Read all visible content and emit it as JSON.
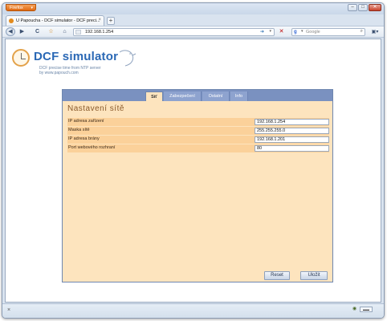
{
  "browser": {
    "app_button_label": "Firefox",
    "window_controls": {
      "minimize": "–",
      "maximize": "□",
      "close": "✕"
    },
    "tab": {
      "title": "U Papoucha - DCF simulator - DCF preci...",
      "close": "×"
    },
    "new_tab": "+",
    "nav": {
      "back": "◀",
      "forward": "▶",
      "reload": "C",
      "bookmark": "☆",
      "home": "⌂",
      "url": "192.168.1.254",
      "go": "➔",
      "url_dropdown": "▾",
      "stop": "✕",
      "search_engine_icon": "g",
      "search_engine_dropdown": "▾",
      "search_placeholder": "Google",
      "search_button": "⌕",
      "menu": "▣▾"
    },
    "status": {
      "close_icon": "×",
      "addon_icon": "◉",
      "box": "▬▬"
    }
  },
  "logo": {
    "title": "DCF simulator",
    "subtitle_line1": "DCF precise time from NTP server",
    "subtitle_line2": "by www.papouch.com"
  },
  "panel": {
    "tabs": [
      {
        "label": "Síť",
        "active": true
      },
      {
        "label": "Zabezpečení",
        "active": false
      },
      {
        "label": "Ostatní",
        "active": false
      },
      {
        "label": "Info",
        "active": false
      }
    ],
    "section_title": "Nastavení sítě",
    "fields": [
      {
        "label": "IP adresa zařízení",
        "value": "192.168.1.254"
      },
      {
        "label": "Maska sítě",
        "value": "255.255.255.0"
      },
      {
        "label": "IP adresa brány",
        "value": "192.168.1.201"
      },
      {
        "label": "Port webového rozhraní",
        "value": "80"
      }
    ],
    "reset_label": "Reset",
    "save_label": "Uložit"
  },
  "colors": {
    "panel_bg": "#fde4be",
    "row_bg": "#fbd19a",
    "tab_bar": "#7a91c0",
    "logo_blue": "#2a68b5",
    "title_brown": "#8a5a2b",
    "firefox_orange": "#e06a12"
  }
}
